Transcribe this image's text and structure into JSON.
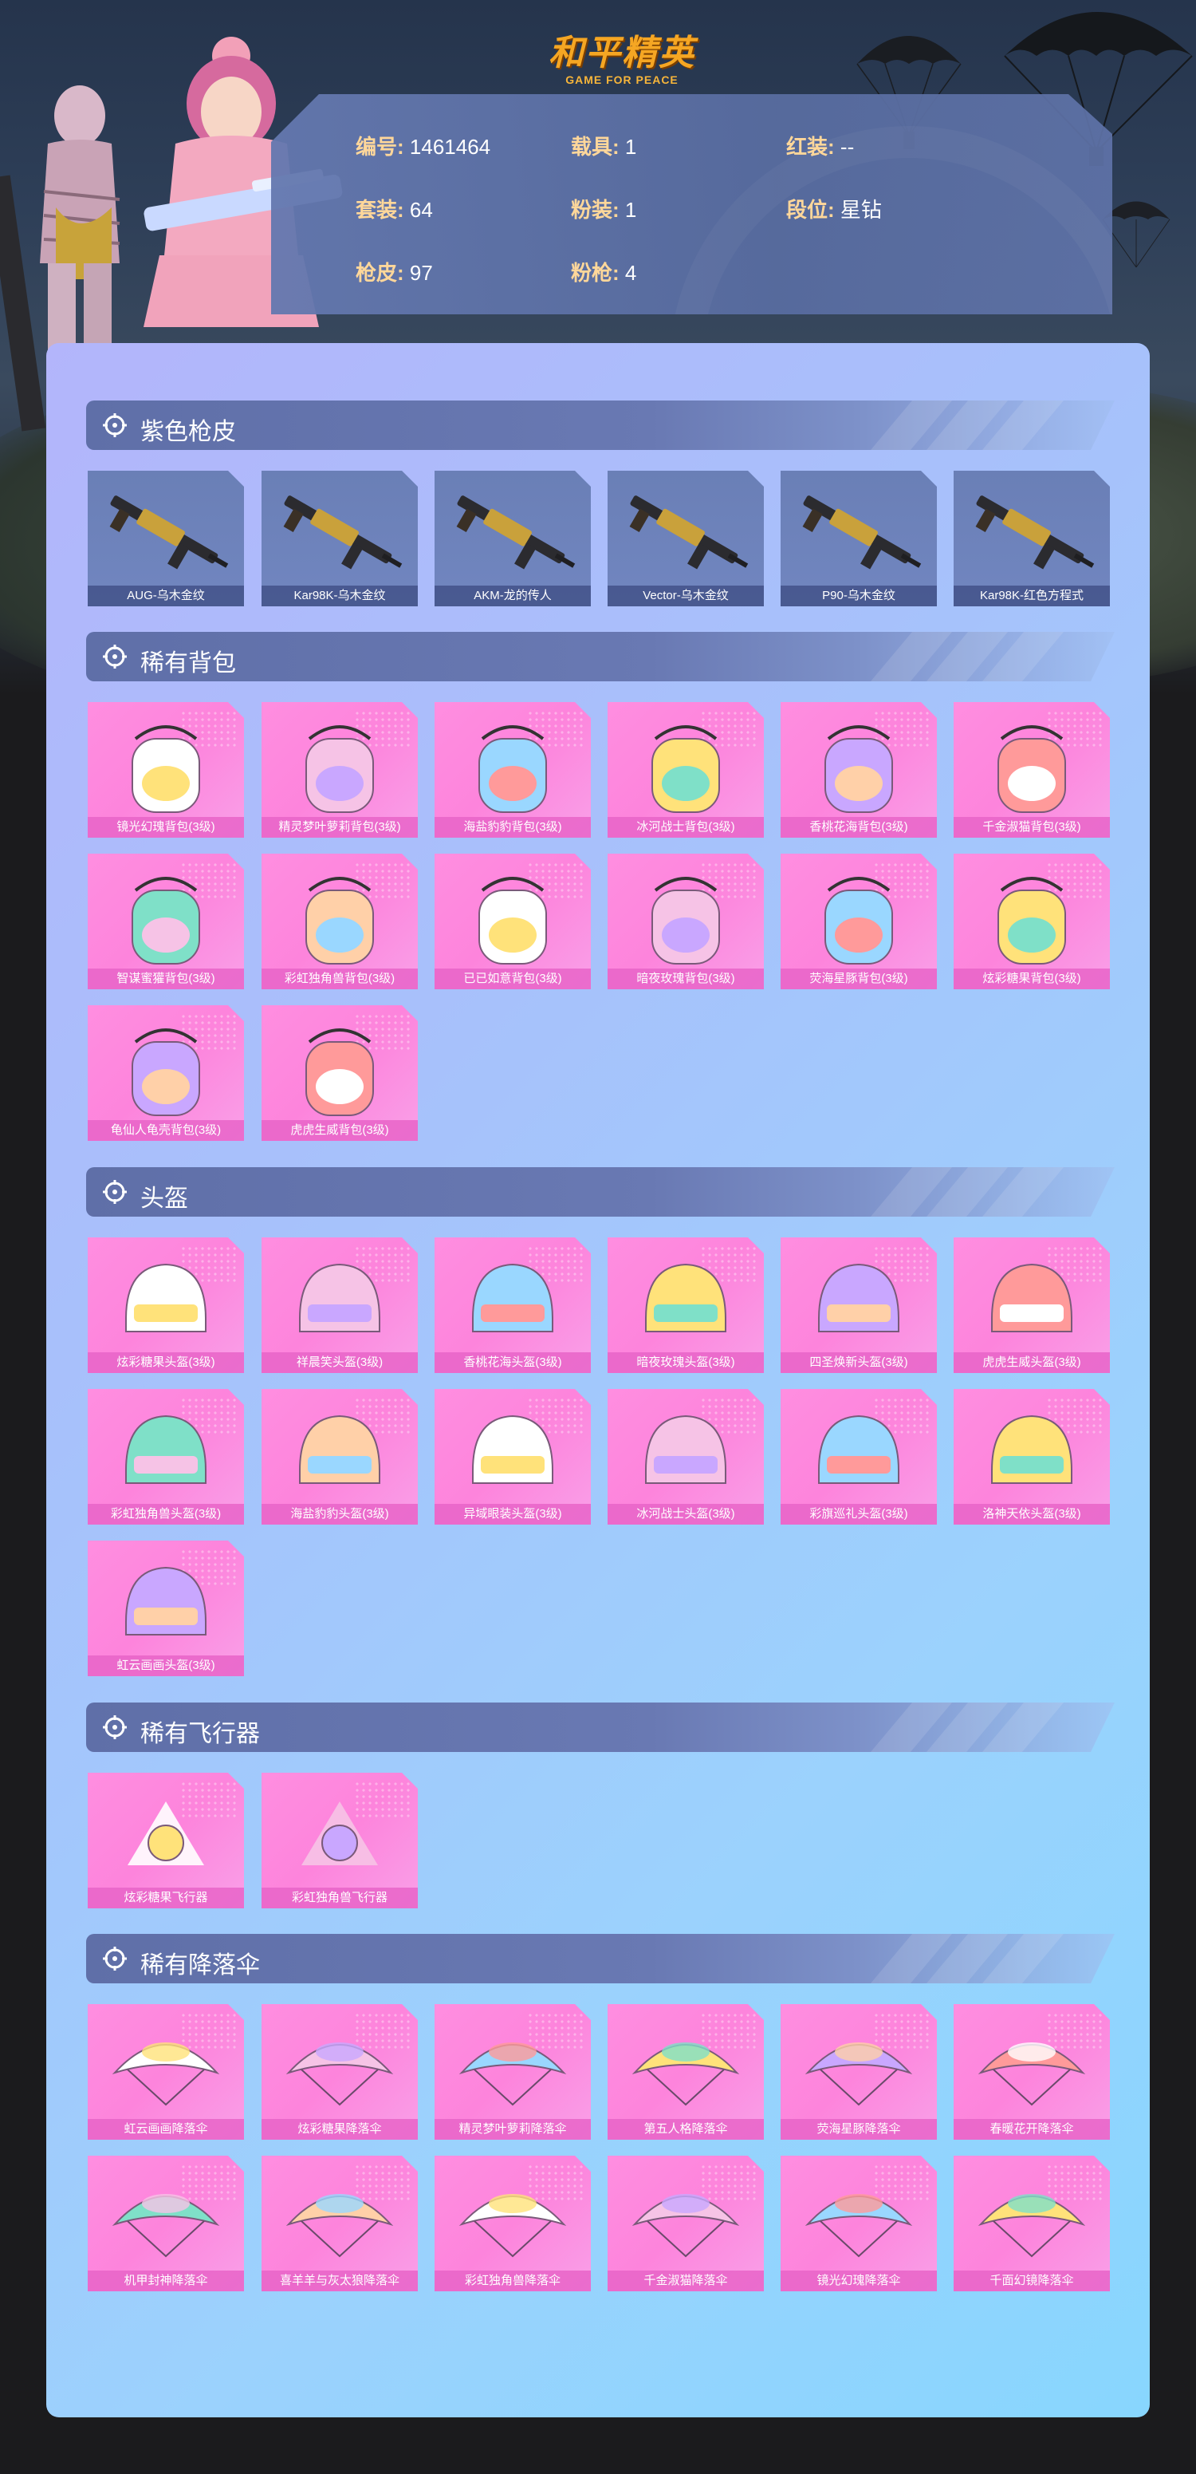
{
  "header": {
    "logo_cn": "和平精英",
    "logo_en": "GAME FOR PEACE"
  },
  "info": [
    {
      "key": "编号:",
      "value": "1461464"
    },
    {
      "key": "载具:",
      "value": "1"
    },
    {
      "key": "红装:",
      "value": "--"
    },
    {
      "key": "套装:",
      "value": "64"
    },
    {
      "key": "粉装:",
      "value": "1"
    },
    {
      "key": "段位:",
      "value": "星钻"
    },
    {
      "key": "枪皮:",
      "value": "97"
    },
    {
      "key": "粉枪:",
      "value": "4"
    }
  ],
  "colors": {
    "accent": "#f5a623",
    "pink_tile": "#fd84dc",
    "gun_tile": "#6a7fb6",
    "header_bar": "#5f6fa8"
  },
  "sections": [
    {
      "title": "紫色枪皮",
      "kind": "gun",
      "items": [
        "AUG-乌木金纹",
        "Kar98K-乌木金纹",
        "AKM-龙的传人",
        "Vector-乌木金纹",
        "P90-乌木金纹",
        "Kar98K-红色方程式"
      ]
    },
    {
      "title": "稀有背包",
      "kind": "pink",
      "items": [
        "镜光幻瑰背包(3级)",
        "精灵梦叶萝莉背包(3级)",
        "海盐豹豹背包(3级)",
        "冰河战士背包(3级)",
        "香桃花海背包(3级)",
        "千金淑猫背包(3级)",
        "智谋蜜獾背包(3级)",
        "彩虹独角兽背包(3级)",
        "已已如意背包(3级)",
        "暗夜玫瑰背包(3级)",
        "荧海星豚背包(3级)",
        "炫彩糖果背包(3级)",
        "龟仙人龟壳背包(3级)",
        "虎虎生威背包(3级)"
      ]
    },
    {
      "title": "头盔",
      "kind": "pink",
      "items": [
        "炫彩糖果头盔(3级)",
        "祥晨笑头盔(3级)",
        "香桃花海头盔(3级)",
        "暗夜玫瑰头盔(3级)",
        "四圣焕新头盔(3级)",
        "虎虎生威头盔(3级)",
        "彩虹独角兽头盔(3级)",
        "海盐豹豹头盔(3级)",
        "异域眼装头盔(3级)",
        "冰河战士头盔(3级)",
        "彩旗巡礼头盔(3级)",
        "洛神天依头盔(3级)",
        "虹云画画头盔(3级)"
      ]
    },
    {
      "title": "稀有飞行器",
      "kind": "pink",
      "items": [
        "炫彩糖果飞行器",
        "彩虹独角兽飞行器"
      ]
    },
    {
      "title": "稀有降落伞",
      "kind": "pink",
      "items": [
        "虹云画画降落伞",
        "炫彩糖果降落伞",
        "精灵梦叶萝莉降落伞",
        "第五人格降落伞",
        "荧海星豚降落伞",
        "春暖花开降落伞",
        "机甲封神降落伞",
        "喜羊羊与灰太狼降落伞",
        "彩虹独角兽降落伞",
        "千金淑猫降落伞",
        "镜光幻瑰降落伞",
        "千面幻镜降落伞"
      ]
    }
  ]
}
